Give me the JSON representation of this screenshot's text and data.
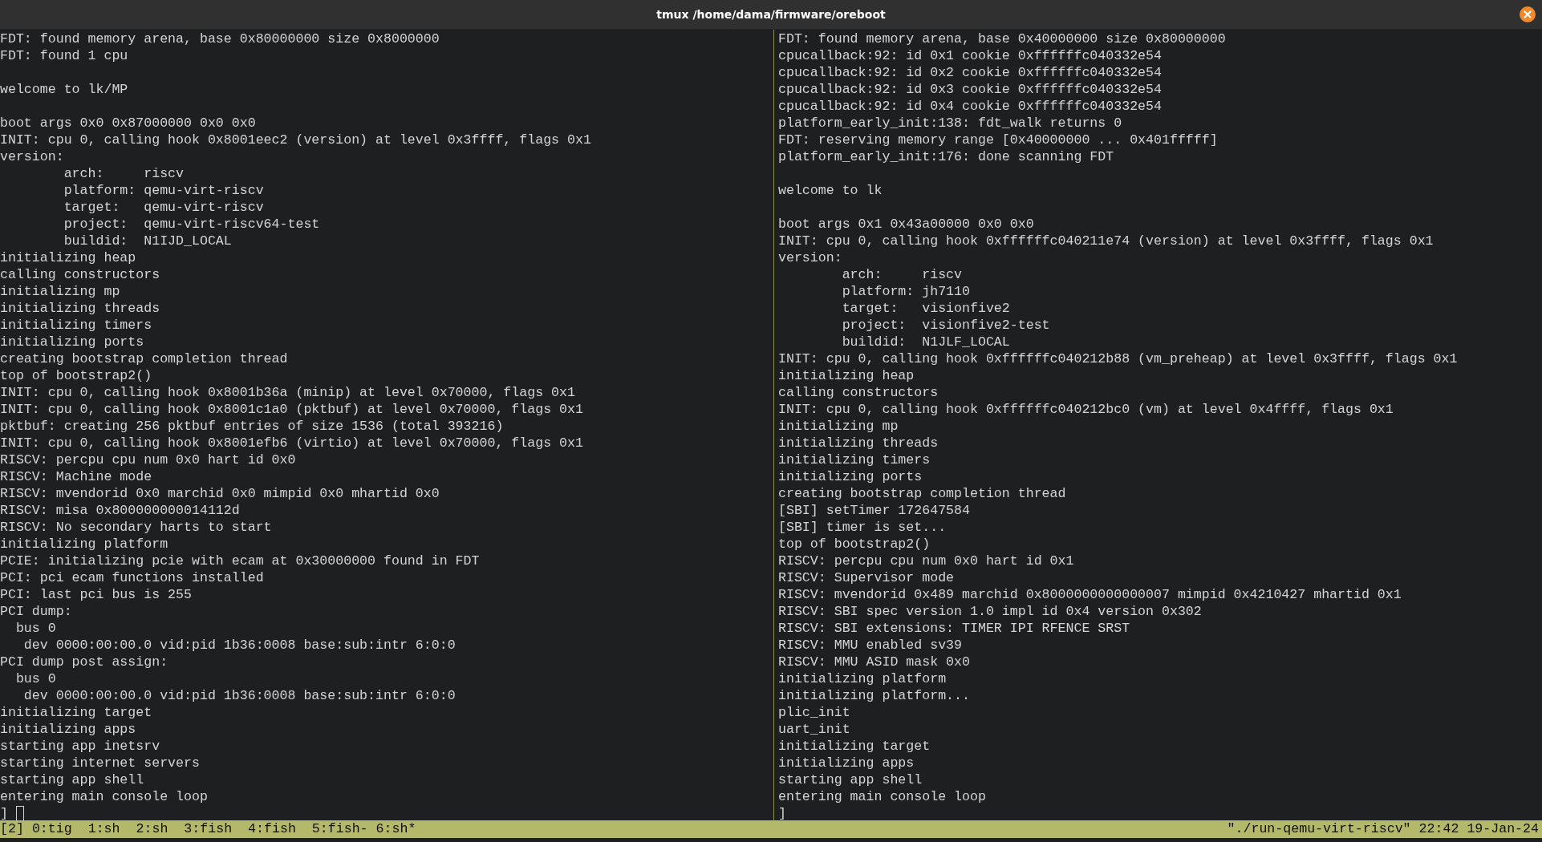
{
  "window": {
    "title": "tmux /home/dama/firmware/oreboot"
  },
  "panes": [
    {
      "cursor": true,
      "lines": [
        "FDT: found memory arena, base 0x80000000 size 0x8000000",
        "FDT: found 1 cpu",
        {
          "kind": "blank"
        },
        "welcome to lk/MP",
        {
          "kind": "blank"
        },
        "boot args 0x0 0x87000000 0x0 0x0",
        "INIT: cpu 0, calling hook 0x8001eec2 (version) at level 0x3ffff, flags 0x1",
        "version:",
        "        arch:     riscv",
        "        platform: qemu-virt-riscv",
        "        target:   qemu-virt-riscv",
        "        project:  qemu-virt-riscv64-test",
        "        buildid:  N1IJD_LOCAL",
        "initializing heap",
        "calling constructors",
        "initializing mp",
        "initializing threads",
        "initializing timers",
        "initializing ports",
        "creating bootstrap completion thread",
        "top of bootstrap2()",
        "INIT: cpu 0, calling hook 0x8001b36a (minip) at level 0x70000, flags 0x1",
        "INIT: cpu 0, calling hook 0x8001c1a0 (pktbuf) at level 0x70000, flags 0x1",
        "pktbuf: creating 256 pktbuf entries of size 1536 (total 393216)",
        "INIT: cpu 0, calling hook 0x8001efb6 (virtio) at level 0x70000, flags 0x1",
        "RISCV: percpu cpu num 0x0 hart id 0x0",
        "RISCV: Machine mode",
        "RISCV: mvendorid 0x0 marchid 0x0 mimpid 0x0 mhartid 0x0",
        "RISCV: misa 0x800000000014112d",
        "RISCV: No secondary harts to start",
        "initializing platform",
        "PCIE: initializing pcie with ecam at 0x30000000 found in FDT",
        "PCI: pci ecam functions installed",
        "PCI: last pci bus is 255",
        "PCI dump:",
        "  bus 0",
        "   dev 0000:00:00.0 vid:pid 1b36:0008 base:sub:intr 6:0:0",
        "PCI dump post assign:",
        "  bus 0",
        "   dev 0000:00:00.0 vid:pid 1b36:0008 base:sub:intr 6:0:0",
        "initializing target",
        "initializing apps",
        "starting app inetsrv",
        "starting internet servers",
        "starting app shell",
        "entering main console loop",
        "]"
      ]
    },
    {
      "cursor": false,
      "lines": [
        "FDT: found memory arena, base 0x40000000 size 0x80000000",
        "cpucallback:92: id 0x1 cookie 0xffffffc040332e54",
        "cpucallback:92: id 0x2 cookie 0xffffffc040332e54",
        "cpucallback:92: id 0x3 cookie 0xffffffc040332e54",
        "cpucallback:92: id 0x4 cookie 0xffffffc040332e54",
        "platform_early_init:138: fdt_walk returns 0",
        "FDT: reserving memory range [0x40000000 ... 0x401fffff]",
        "platform_early_init:176: done scanning FDT",
        {
          "kind": "blank"
        },
        "welcome to lk",
        {
          "kind": "blank"
        },
        "boot args 0x1 0x43a00000 0x0 0x0",
        "INIT: cpu 0, calling hook 0xffffffc040211e74 (version) at level 0x3ffff, flags 0x1",
        "version:",
        "        arch:     riscv",
        "        platform: jh7110",
        "        target:   visionfive2",
        "        project:  visionfive2-test",
        "        buildid:  N1JLF_LOCAL",
        "INIT: cpu 0, calling hook 0xffffffc040212b88 (vm_preheap) at level 0x3ffff, flags 0x1",
        "initializing heap",
        "calling constructors",
        "INIT: cpu 0, calling hook 0xffffffc040212bc0 (vm) at level 0x4ffff, flags 0x1",
        "initializing mp",
        "initializing threads",
        "initializing timers",
        "initializing ports",
        "creating bootstrap completion thread",
        "[SBI] setTimer 172647584",
        "[SBI] timer is set...",
        "top of bootstrap2()",
        "RISCV: percpu cpu num 0x0 hart id 0x1",
        "RISCV: Supervisor mode",
        "RISCV: mvendorid 0x489 marchid 0x8000000000000007 mimpid 0x4210427 mhartid 0x1",
        "RISCV: SBI spec version 1.0 impl id 0x4 version 0x302",
        "RISCV: SBI extensions: TIMER IPI RFENCE SRST",
        "RISCV: MMU enabled sv39",
        "RISCV: MMU ASID mask 0x0",
        "initializing platform",
        "initializing platform...",
        "plic_init",
        "uart_init",
        "initializing target",
        "initializing apps",
        "starting app shell",
        "entering main console loop",
        "]"
      ]
    }
  ],
  "status_bar": {
    "session": "[2]",
    "windows": [
      "0:tig",
      "1:sh",
      "2:sh",
      "3:fish",
      "4:fish",
      "5:fish-",
      "6:sh*"
    ],
    "pane_title": "\"./run-qemu-virt-riscv\"",
    "time": "22:42",
    "date": "19-Jan-24"
  }
}
